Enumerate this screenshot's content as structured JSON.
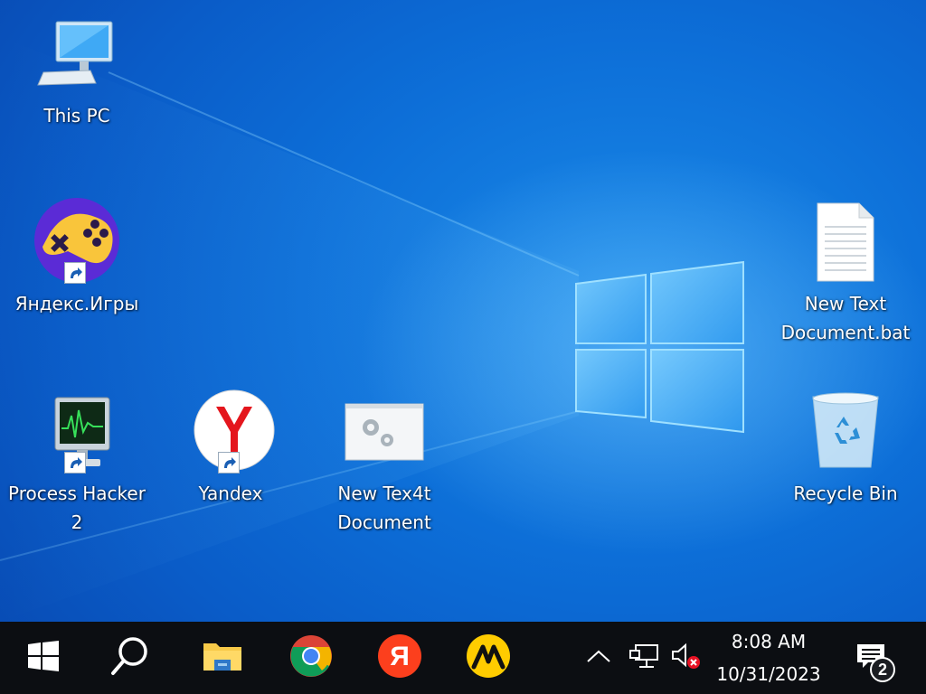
{
  "desktop": {
    "icons": [
      {
        "label": "This PC",
        "icon": "computer-icon"
      },
      {
        "label": "Яндекс.Игры",
        "icon": "yandex-games-icon"
      },
      {
        "label": "Process Hacker 2",
        "icon": "process-hacker-icon"
      },
      {
        "label": "Yandex",
        "icon": "yandex-browser-icon"
      },
      {
        "label": "New Tex4t Document",
        "icon": "settings-file-icon"
      },
      {
        "label": "New Text Document.bat",
        "icon": "text-document-icon"
      },
      {
        "label": "Recycle Bin",
        "icon": "recycle-bin-icon"
      }
    ]
  },
  "taskbar": {
    "buttons": [
      {
        "name": "start",
        "icon": "windows-logo-icon"
      },
      {
        "name": "search",
        "icon": "search-icon"
      },
      {
        "name": "file-explorer",
        "icon": "folder-icon"
      },
      {
        "name": "chrome",
        "icon": "chrome-icon"
      },
      {
        "name": "yandex",
        "icon": "yandex-icon"
      },
      {
        "name": "yandex-market",
        "icon": "yandex-market-icon"
      }
    ],
    "tray": {
      "time": "8:08 AM",
      "date": "10/31/2023",
      "notification_count": "2"
    }
  },
  "colors": {
    "taskbar": "#0c0e12",
    "desktop": "#0a63d2",
    "yandex_red": "#fc3f1d",
    "mute_red": "#e81123"
  }
}
